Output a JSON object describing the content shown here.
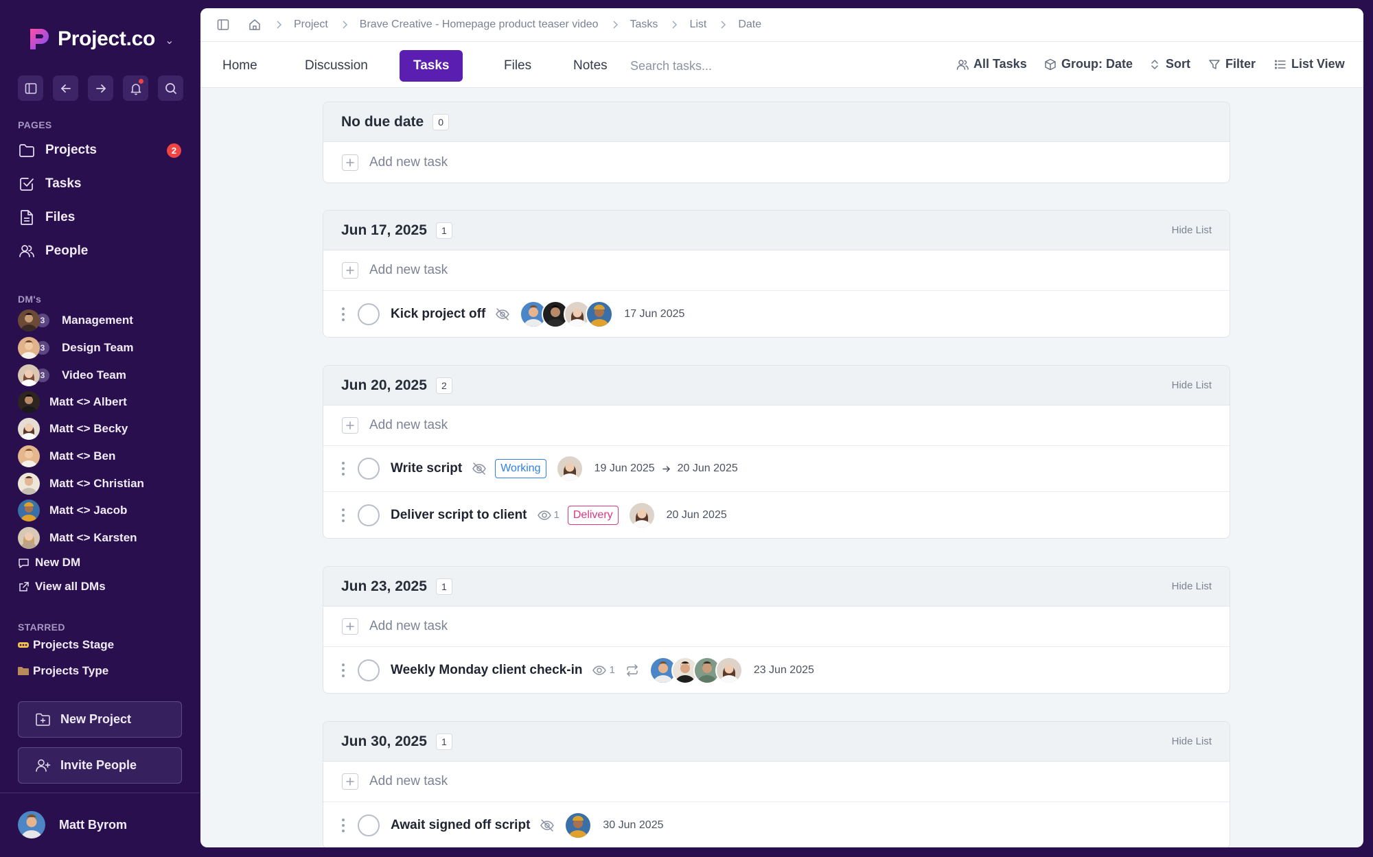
{
  "app": {
    "brand": "Project.co",
    "colors": {
      "sidebar": "#2a0f4f",
      "accent": "#5a1fb0",
      "badge": "#ef4444",
      "working": "#2f80ed",
      "delivery": "#e0357f"
    }
  },
  "sidebar": {
    "tools": [
      {
        "icon": "sidebar-toggle-icon"
      },
      {
        "icon": "arrow-left-icon"
      },
      {
        "icon": "arrow-right-icon"
      },
      {
        "icon": "bell-icon"
      },
      {
        "icon": "search-icon"
      }
    ],
    "pages_label": "PAGES",
    "pages": [
      {
        "label": "Projects",
        "icon": "folder-icon",
        "badge": "2"
      },
      {
        "label": "Tasks",
        "icon": "task-check-icon"
      },
      {
        "label": "Files",
        "icon": "file-icon"
      },
      {
        "label": "People",
        "icon": "people-icon"
      }
    ],
    "dms_label": "DM's",
    "dms": [
      {
        "label": "Management",
        "count": "3"
      },
      {
        "label": "Design Team",
        "count": "3"
      },
      {
        "label": "Video Team",
        "count": "3"
      },
      {
        "label": "Matt <> Albert"
      },
      {
        "label": "Matt <> Becky"
      },
      {
        "label": "Matt <> Ben"
      },
      {
        "label": "Matt <> Christian"
      },
      {
        "label": "Matt <> Jacob"
      },
      {
        "label": "Matt <> Karsten"
      }
    ],
    "new_dm": "New DM",
    "view_all_dms": "View all DMs",
    "starred_label": "STARRED",
    "starred": [
      {
        "label": "Projects Stage",
        "icon": "dots-icon"
      },
      {
        "label": "Projects Type",
        "icon": "folder-emoji-icon"
      }
    ],
    "new_project": "New Project",
    "invite_people": "Invite People",
    "user": "Matt Byrom"
  },
  "breadcrumb": [
    "Project",
    "Brave Creative - Homepage product teaser video",
    "Tasks",
    "List",
    "Date"
  ],
  "tabs": [
    "Home",
    "Discussion",
    "Tasks",
    "Files",
    "Notes"
  ],
  "active_tab": "Tasks",
  "search": {
    "placeholder": "Search tasks..."
  },
  "toolbar": {
    "all_tasks": "All Tasks",
    "group": "Group: Date",
    "sort": "Sort",
    "filter": "Filter",
    "view": "List View"
  },
  "add_task_label": "Add new task",
  "hide_list_label": "Hide List",
  "groups": [
    {
      "title": "No due date",
      "count": "0",
      "tasks": []
    },
    {
      "title": "Jun 17, 2025",
      "count": "1",
      "tasks": [
        {
          "name": "Kick project off",
          "icon": "eye-off-icon",
          "date": "17 Jun 2025"
        }
      ]
    },
    {
      "title": "Jun 20, 2025",
      "count": "2",
      "tasks": [
        {
          "name": "Write script",
          "icon": "eye-off-icon",
          "tag": "Working",
          "date_start": "19 Jun 2025",
          "date_end": "20 Jun 2025"
        },
        {
          "name": "Deliver script to client",
          "icon": "eye-icon",
          "watchers": "1",
          "tag": "Delivery",
          "date": "20 Jun 2025"
        }
      ]
    },
    {
      "title": "Jun 23, 2025",
      "count": "1",
      "tasks": [
        {
          "name": "Weekly Monday client check-in",
          "icon": "eye-icon",
          "watchers": "1",
          "repeat": "repeat-icon",
          "date": "23 Jun 2025"
        }
      ]
    },
    {
      "title": "Jun 30, 2025",
      "count": "1",
      "tasks": [
        {
          "name": "Await signed off script",
          "icon": "eye-off-icon",
          "date": "30 Jun 2025"
        }
      ]
    }
  ]
}
